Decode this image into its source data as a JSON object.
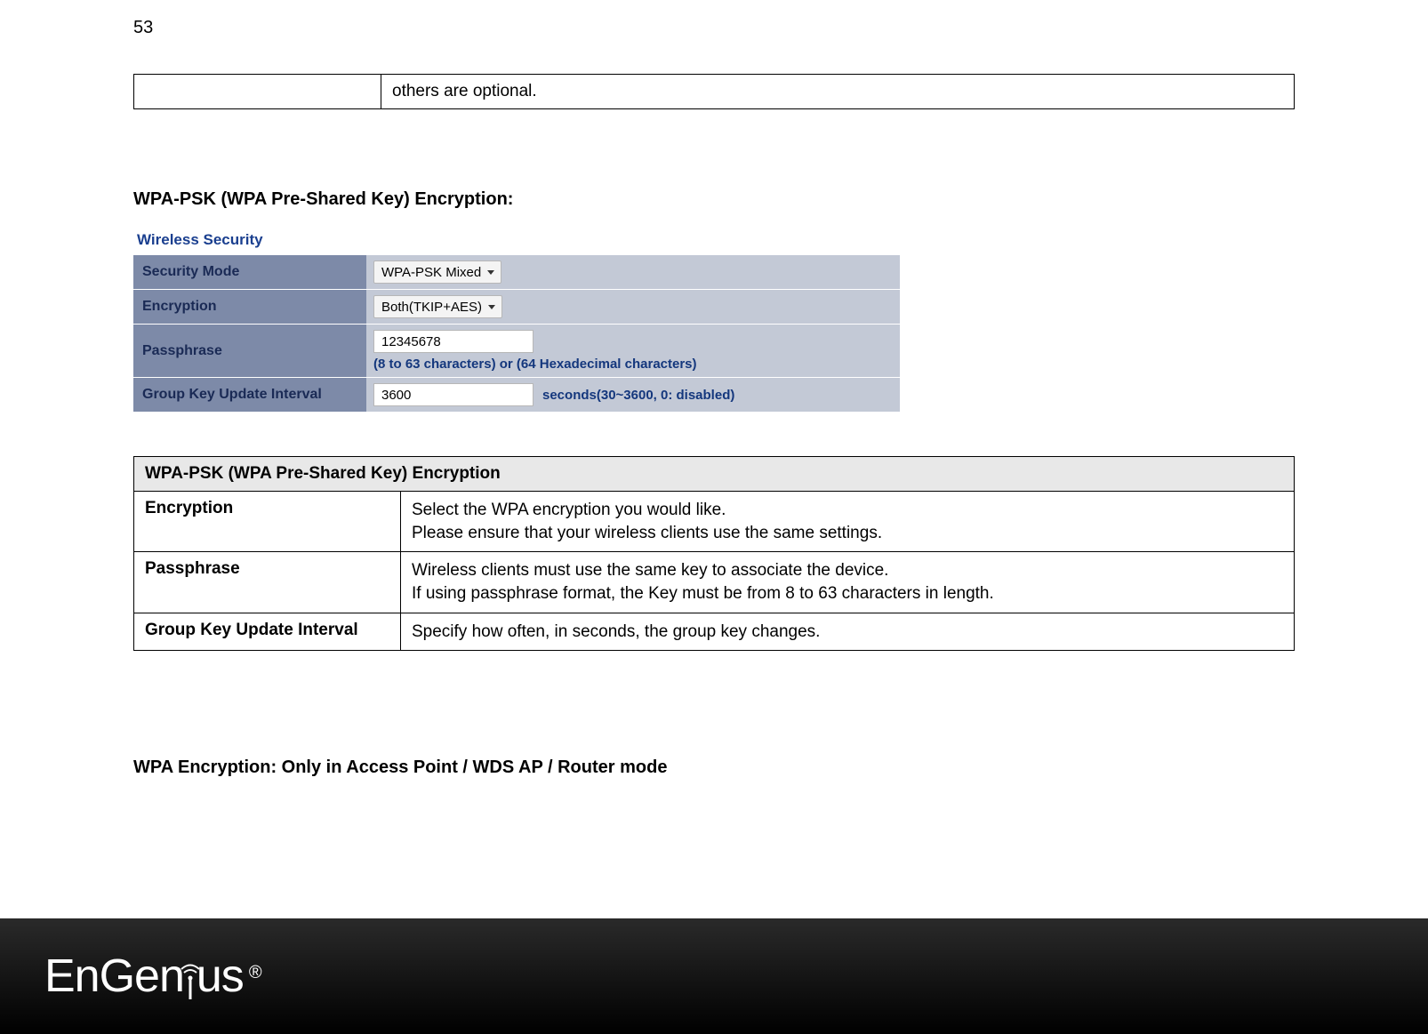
{
  "page_number": "53",
  "top_fragment": {
    "left_cell": "",
    "right_cell": "others are optional."
  },
  "section1_heading": "WPA-PSK (WPA Pre-Shared Key) Encryption:",
  "wireless_security": {
    "title": "Wireless Security",
    "rows": {
      "security_mode": {
        "label": "Security Mode",
        "value": "WPA-PSK Mixed"
      },
      "encryption": {
        "label": "Encryption",
        "value": "Both(TKIP+AES)"
      },
      "passphrase": {
        "label": "Passphrase",
        "value": "12345678",
        "hint": "(8 to 63 characters) or (64 Hexadecimal characters)"
      },
      "group_key": {
        "label": "Group Key Update Interval",
        "value": "3600",
        "hint": "seconds(30~3600, 0: disabled)"
      }
    }
  },
  "desc_table": {
    "header": "WPA-PSK (WPA Pre-Shared Key) Encryption",
    "rows": [
      {
        "label": "Encryption",
        "desc": "Select the WPA encryption you would like.\nPlease ensure that your wireless clients use the same settings."
      },
      {
        "label": "Passphrase",
        "desc": "Wireless clients must use the same key to associate the device.\nIf using passphrase format, the Key must be from 8 to 63 characters in length."
      },
      {
        "label": "Group Key Update Interval",
        "desc": "Specify how often, in seconds, the group key changes."
      }
    ]
  },
  "section2_heading": "WPA Encryption: Only in Access Point / WDS AP / Router mode",
  "footer_logo": {
    "part1": "EnGen",
    "part2": "us",
    "reg": "®"
  }
}
